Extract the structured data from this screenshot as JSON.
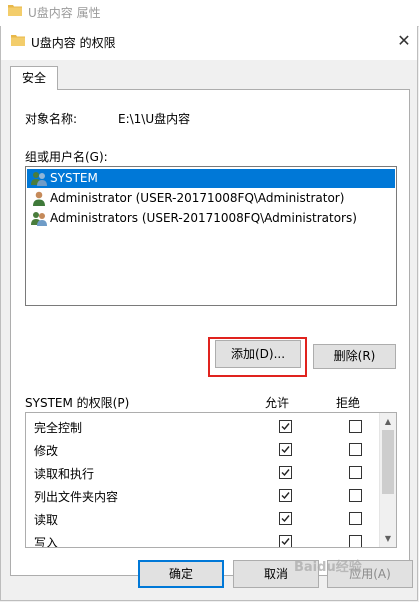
{
  "background_window": {
    "title": "U盘内容 属性"
  },
  "dialog": {
    "title": "U盘内容 的权限",
    "close_glyph": "✕"
  },
  "tab": {
    "label": "安全"
  },
  "object": {
    "label": "对象名称:",
    "value": "E:\\1\\U盘内容"
  },
  "groups": {
    "label": "组或用户名(G):",
    "items": [
      {
        "name": "SYSTEM",
        "icon": "group-users-icon",
        "selected": true
      },
      {
        "name": "Administrator (USER-20171008FQ\\Administrator)",
        "icon": "user-icon",
        "selected": false
      },
      {
        "name": "Administrators (USER-20171008FQ\\Administrators)",
        "icon": "group-users-icon",
        "selected": false
      }
    ]
  },
  "buttons": {
    "add": "添加(D)...",
    "remove": "删除(R)",
    "ok": "确定",
    "cancel": "取消",
    "apply": "应用(A)"
  },
  "permissions": {
    "label": "SYSTEM 的权限(P)",
    "allow_header": "允许",
    "deny_header": "拒绝",
    "rows": [
      {
        "name": "完全控制",
        "allow": true,
        "deny": false
      },
      {
        "name": "修改",
        "allow": true,
        "deny": false
      },
      {
        "name": "读取和执行",
        "allow": true,
        "deny": false
      },
      {
        "name": "列出文件夹内容",
        "allow": true,
        "deny": false
      },
      {
        "name": "读取",
        "allow": true,
        "deny": false
      },
      {
        "name": "写入",
        "allow": true,
        "deny": false
      }
    ]
  },
  "colors": {
    "selection": "#0078d7",
    "highlight_box": "#e0231e",
    "folder": "#e8b84a"
  },
  "watermark": "Baidu经验"
}
